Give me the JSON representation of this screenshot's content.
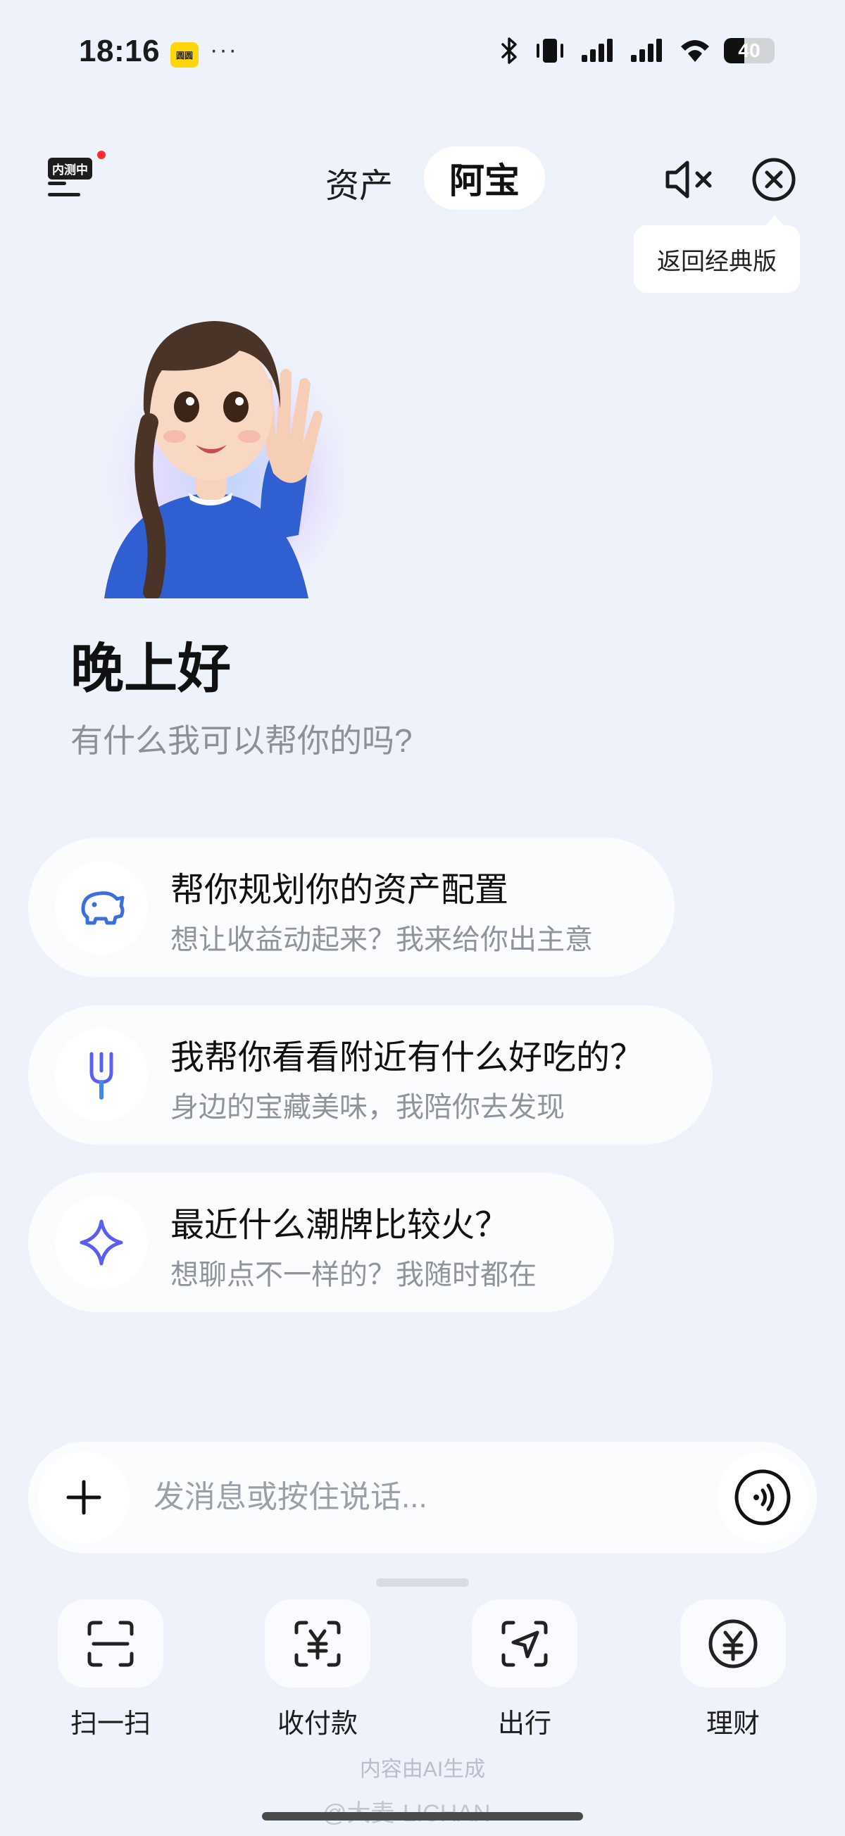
{
  "status_bar": {
    "time": "18:16",
    "app_badge": "圆圆",
    "more": "···",
    "battery": "40",
    "battery_level": 0.4
  },
  "header": {
    "beta_badge": "内测中",
    "tab_assets": "资产",
    "tab_abao": "阿宝",
    "tooltip": "返回经典版"
  },
  "greeting": {
    "title": "晚上好",
    "subtitle": "有什么我可以帮你的吗?"
  },
  "suggestions": [
    {
      "title": "帮你规划你的资产配置",
      "subtitle": "想让收益动起来？我来给你出主意",
      "icon": "piggy-bank-icon"
    },
    {
      "title": "我帮你看看附近有什么好吃的？",
      "subtitle": "身边的宝藏美味，我陪你去发现",
      "icon": "fork-icon"
    },
    {
      "title": "最近什么潮牌比较火？",
      "subtitle": "想聊点不一样的？我随时都在",
      "icon": "sparkle-icon"
    }
  ],
  "input": {
    "placeholder": "发消息或按住说话..."
  },
  "actions": [
    {
      "label": "扫一扫",
      "icon": "scan-icon"
    },
    {
      "label": "收付款",
      "icon": "payment-icon"
    },
    {
      "label": "出行",
      "icon": "navigation-icon"
    },
    {
      "label": "理财",
      "icon": "yuan-coin-icon"
    }
  ],
  "footer": {
    "ai_note": "内容由AI生成",
    "watermark": "@大麦-LICHAN"
  },
  "colors": {
    "background": "#eef2fb",
    "accent_blue": "#3b6fe0",
    "accent_purple": "#6a5ee8"
  }
}
